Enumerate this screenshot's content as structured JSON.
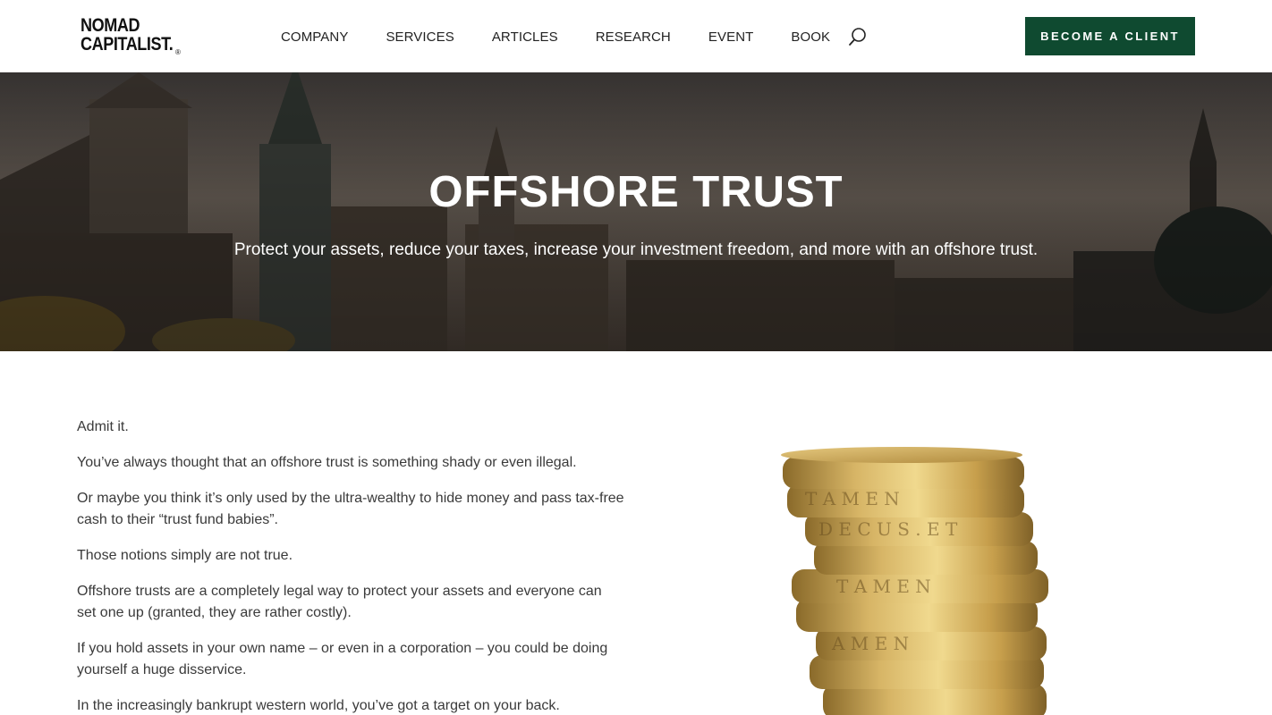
{
  "brand": {
    "line1": "NOMAD",
    "line2": "CAPITALIST",
    "dot": ".",
    "reg": "®"
  },
  "nav": [
    {
      "label": "COMPANY"
    },
    {
      "label": "SERVICES"
    },
    {
      "label": "ARTICLES"
    },
    {
      "label": "RESEARCH"
    },
    {
      "label": "EVENT"
    },
    {
      "label": "BOOK"
    }
  ],
  "icons": {
    "search": "search-icon"
  },
  "cta_label": "BECOME A CLIENT",
  "hero": {
    "title": "OFFSHORE TRUST",
    "subtitle": "Protect your assets, reduce your taxes, increase your investment freedom, and more with an offshore trust."
  },
  "body": [
    "Admit it.",
    "You’ve always thought that an offshore trust is something shady or even illegal.",
    "Or maybe you think it’s only used by the ultra-wealthy to hide money and pass tax-free cash to their “trust fund babies”.",
    "Those notions simply are not true.",
    "Offshore trusts are a completely legal way to protect your assets and everyone can set one up (granted, they are rather costly).",
    "If you hold assets in your own name – or even in a corporation – you could be doing yourself a huge disservice.",
    "In the increasingly bankrupt western world, you’ve got a target on your back."
  ],
  "colors": {
    "accent": "#0f4a30",
    "hero_text": "#ffffff",
    "body_text": "#3a3a3a",
    "coin_gold": "#c9a24a"
  }
}
